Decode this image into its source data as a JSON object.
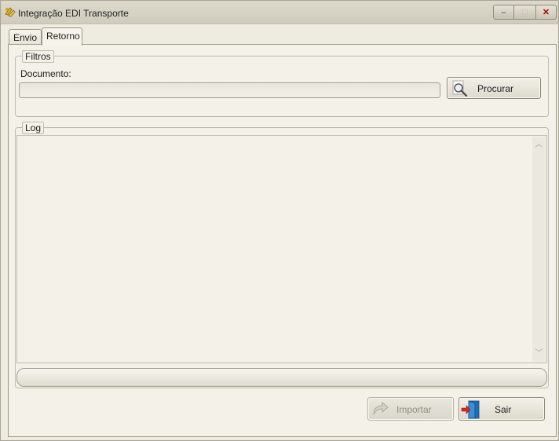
{
  "window": {
    "title": "Integração EDI Transporte",
    "controls": {
      "minimize": "–",
      "maximize": "□",
      "close": "✕"
    }
  },
  "tabs": [
    {
      "label": "Envio",
      "active": false
    },
    {
      "label": "Retorno",
      "active": true
    }
  ],
  "filtros": {
    "legend": "Filtros",
    "documento_label": "Documento:",
    "documento_value": "",
    "procurar_label": "Procurar",
    "procurar_icon": "magnifier-icon"
  },
  "log": {
    "legend": "Log",
    "content": ""
  },
  "actions": {
    "importar_label": "Importar",
    "importar_enabled": false,
    "importar_icon": "redo-arrow-icon",
    "sair_label": "Sair",
    "sair_icon": "exit-door-icon"
  },
  "colors": {
    "accent_close": "#b00000",
    "door_blue": "#1f6fb8",
    "arrow_red": "#d62a1e"
  }
}
